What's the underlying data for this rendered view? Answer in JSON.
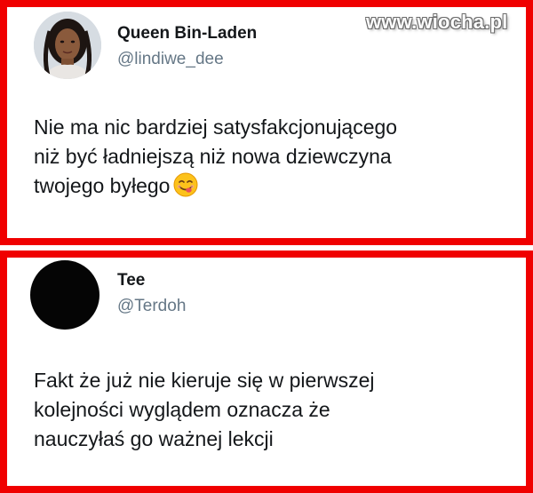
{
  "watermark": "www.wiocha.pl",
  "tweets": [
    {
      "name": "Queen Bin-Laden",
      "handle": "@lindiwe_dee",
      "text": "Nie ma nic bardziej satysfakcjonującego\nniż być ładniejszą niż nowa dziewczyna\ntwojego byłego",
      "emoji": "savoring-food-face-emoji",
      "avatar": "profile-photo"
    },
    {
      "name": "Tee",
      "handle": "@Terdoh",
      "text": "Fakt że już nie kieruje się w pierwszej\nkolejności wyglądem oznacza że\nnauczyłaś go ważnej lekcji",
      "avatar": "black-circle"
    }
  ],
  "colors": {
    "frame": "#f00000",
    "name": "#14171a",
    "handle": "#657786"
  }
}
